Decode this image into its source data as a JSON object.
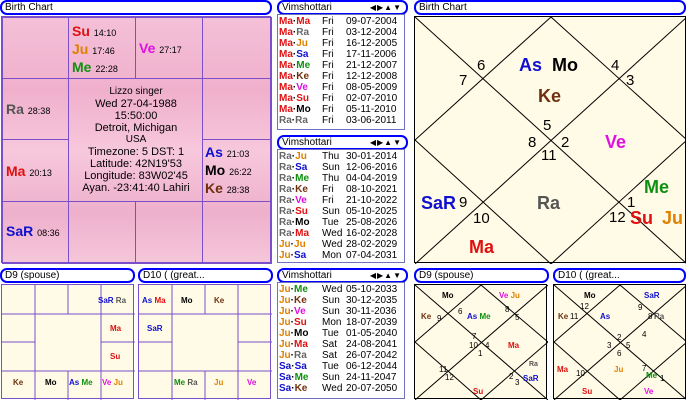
{
  "headers": {
    "birth_chart_left": "Birth Chart",
    "vimshottari_1": "Vimshottari",
    "vimshottari_2": "Vimshottari",
    "vimshottari_3": "Vimshottari",
    "birth_chart_right": "Birth Chart",
    "d9_left": "D9  (spouse)",
    "d10_left": "D10 ( (great...",
    "d9_right": "D9  (spouse)",
    "d10_right": "D10 ( (great...",
    "nav_arrows": "◀▶▲▼"
  },
  "south_chart": {
    "info": {
      "name": "Lizzo singer",
      "date": "Wed 27-04-1988",
      "time": "15:50:00",
      "city": "Detroit, Michigan",
      "country": "USA",
      "timezone": "Timezone: 5 DST: 1",
      "latitude": "Latitude: 42N19'53",
      "longitude": "Longitude: 83W02'45",
      "ayanamsa": "Ayan. -23:41:40 Lahiri"
    },
    "su": {
      "p": "Su",
      "d": "14:10"
    },
    "ju": {
      "p": "Ju",
      "d": "17:46"
    },
    "me": {
      "p": "Me",
      "d": "22:28"
    },
    "ve": {
      "p": "Ve",
      "d": "27:17"
    },
    "ra": {
      "p": "Ra",
      "d": "28:38"
    },
    "ma": {
      "p": "Ma",
      "d": "20:13"
    },
    "as": {
      "p": "As",
      "d": "21:03"
    },
    "mo": {
      "p": "Mo",
      "d": "26:22"
    },
    "ke": {
      "p": "Ke",
      "d": "28:38"
    },
    "sa": {
      "p": "SaR",
      "d": "08:36"
    }
  },
  "dasha1": [
    {
      "p": "Ma·Ma",
      "day": "Fri",
      "date": "09-07-2004"
    },
    {
      "p": "Ma·Ra",
      "day": "Fri",
      "date": "03-12-2004"
    },
    {
      "p": "Ma·Ju",
      "day": "Fri",
      "date": "16-12-2005"
    },
    {
      "p": "Ma·Sa",
      "day": "Fri",
      "date": "17-11-2006"
    },
    {
      "p": "Ma·Me",
      "day": "Fri",
      "date": "21-12-2007"
    },
    {
      "p": "Ma·Ke",
      "day": "Fri",
      "date": "12-12-2008"
    },
    {
      "p": "Ma·Ve",
      "day": "Fri",
      "date": "08-05-2009"
    },
    {
      "p": "Ma·Su",
      "day": "Fri",
      "date": "02-07-2010"
    },
    {
      "p": "Ma·Mo",
      "day": "Fri",
      "date": "05-11-2010"
    },
    {
      "p": "Ra·Ra",
      "day": "Fri",
      "date": "03-06-2011"
    }
  ],
  "dasha2": [
    {
      "p": "Ra·Ju",
      "day": "Thu",
      "date": "30-01-2014"
    },
    {
      "p": "Ra·Sa",
      "day": "Sun",
      "date": "12-06-2016"
    },
    {
      "p": "Ra·Me",
      "day": "Thu",
      "date": "04-04-2019"
    },
    {
      "p": "Ra·Ke",
      "day": "Fri",
      "date": "08-10-2021"
    },
    {
      "p": "Ra·Ve",
      "day": "Fri",
      "date": "21-10-2022"
    },
    {
      "p": "Ra·Su",
      "day": "Sun",
      "date": "05-10-2025"
    },
    {
      "p": "Ra·Mo",
      "day": "Tue",
      "date": "25-08-2026"
    },
    {
      "p": "Ra·Ma",
      "day": "Wed",
      "date": "16-02-2028"
    },
    {
      "p": "Ju·Ju",
      "day": "Wed",
      "date": "28-02-2029"
    },
    {
      "p": "Ju·Sa",
      "day": "Mon",
      "date": "07-04-2031"
    }
  ],
  "dasha3": [
    {
      "p": "Ju·Me",
      "day": "Wed",
      "date": "05-10-2033"
    },
    {
      "p": "Ju·Ke",
      "day": "Sun",
      "date": "30-12-2035"
    },
    {
      "p": "Ju·Ve",
      "day": "Sun",
      "date": "30-11-2036"
    },
    {
      "p": "Ju·Su",
      "day": "Mon",
      "date": "18-07-2039"
    },
    {
      "p": "Ju·Mo",
      "day": "Tue",
      "date": "01-05-2040"
    },
    {
      "p": "Ju·Ma",
      "day": "Sat",
      "date": "24-08-2041"
    },
    {
      "p": "Ju·Ra",
      "day": "Sat",
      "date": "26-07-2042"
    },
    {
      "p": "Sa·Sa",
      "day": "Tue",
      "date": "06-12-2044"
    },
    {
      "p": "Sa·Me",
      "day": "Sun",
      "date": "24-11-2047"
    },
    {
      "p": "Sa·Ke",
      "day": "Wed",
      "date": "20-07-2050"
    }
  ],
  "north_chart": {
    "house_numbers": [
      "5",
      "6",
      "7",
      "8",
      "9",
      "10",
      "11",
      "12",
      "1",
      "2",
      "3",
      "4"
    ],
    "as": "As",
    "mo": "Mo",
    "ke": "Ke",
    "ve": "Ve",
    "sa": "SaR",
    "ra": "Ra",
    "ma": "Ma",
    "me": "Me",
    "su": "Su",
    "ju": "Ju"
  },
  "d9_south": {
    "sa": "SaR",
    "ra": "Ra",
    "ma": "Ma",
    "su": "Su",
    "ke": "Ke",
    "mo": "Mo",
    "as": "As",
    "me": "Me",
    "ve": "Ve",
    "ju": "Ju"
  },
  "d10_south": {
    "as": "As",
    "ma": "Ma",
    "mo": "Mo",
    "ke": "Ke",
    "sa": "SaR",
    "me": "Me",
    "ra": "Ra",
    "ju": "Ju",
    "ve": "Ve"
  },
  "d9_north": {
    "nums": [
      "7",
      "8",
      "5",
      "10",
      "4",
      "1",
      "2",
      "3",
      "11",
      "12",
      "6",
      "9"
    ],
    "mo": "Mo",
    "ve": "Ve",
    "ju": "Ju",
    "ke": "Ke",
    "as": "As",
    "me": "Me",
    "ma": "Ma",
    "sa": "SaR",
    "ra": "Ra",
    "su": "Su"
  },
  "d10_north": {
    "nums": [
      "12",
      "11",
      "9",
      "8",
      "3",
      "2",
      "5",
      "6",
      "4",
      "7",
      "10",
      "1"
    ],
    "mo": "Mo",
    "sa": "SaR",
    "ke": "Ke",
    "as": "As",
    "ra": "Ra",
    "ju": "Ju",
    "ma": "Ma",
    "me": "Me",
    "su": "Su",
    "ve": "Ve"
  }
}
